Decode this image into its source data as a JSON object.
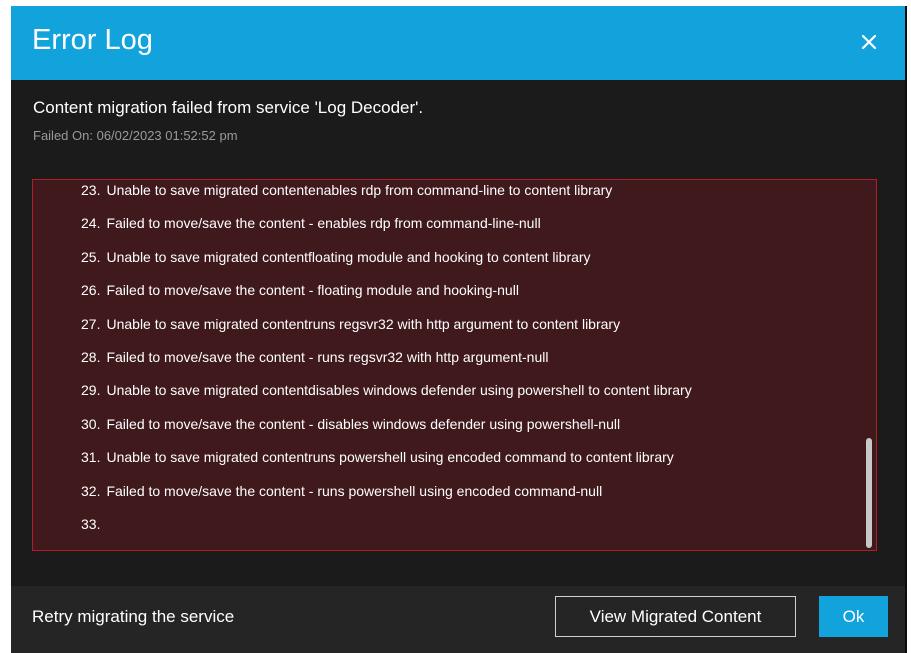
{
  "dialog": {
    "title": "Error Log",
    "close_icon": "close-icon",
    "message": "Content migration failed from service 'Log Decoder'.",
    "failed_on": "Failed On: 06/02/2023 01:52:52 pm"
  },
  "log": {
    "items": [
      {
        "num": "23.",
        "text": "Unable to save migrated contentenables rdp from command-line to content library"
      },
      {
        "num": "24.",
        "text": "Failed to move/save the content - enables rdp from command-line-null"
      },
      {
        "num": "25.",
        "text": "Unable to save migrated contentfloating module and hooking to content library"
      },
      {
        "num": "26.",
        "text": "Failed to move/save the content - floating module and hooking-null"
      },
      {
        "num": "27.",
        "text": "Unable to save migrated contentruns regsvr32 with http argument to content library"
      },
      {
        "num": "28.",
        "text": "Failed to move/save the content - runs regsvr32 with http argument-null"
      },
      {
        "num": "29.",
        "text": "Unable to save migrated contentdisables windows defender using powershell to content library"
      },
      {
        "num": "30.",
        "text": "Failed to move/save the content - disables windows defender using powershell-null"
      },
      {
        "num": "31.",
        "text": "Unable to save migrated contentruns powershell using encoded command to content library"
      },
      {
        "num": "32.",
        "text": "Failed to move/save the content - runs powershell using encoded command-null"
      },
      {
        "num": "33.",
        "text": ""
      }
    ]
  },
  "footer": {
    "retry_label": "Retry migrating the service",
    "view_button_label": "View Migrated Content",
    "ok_button_label": "Ok"
  },
  "colors": {
    "accent": "#12a3dc",
    "dialog_bg": "#1b1b1b",
    "error_bg": "#3f191c",
    "error_border": "#b21d26"
  }
}
